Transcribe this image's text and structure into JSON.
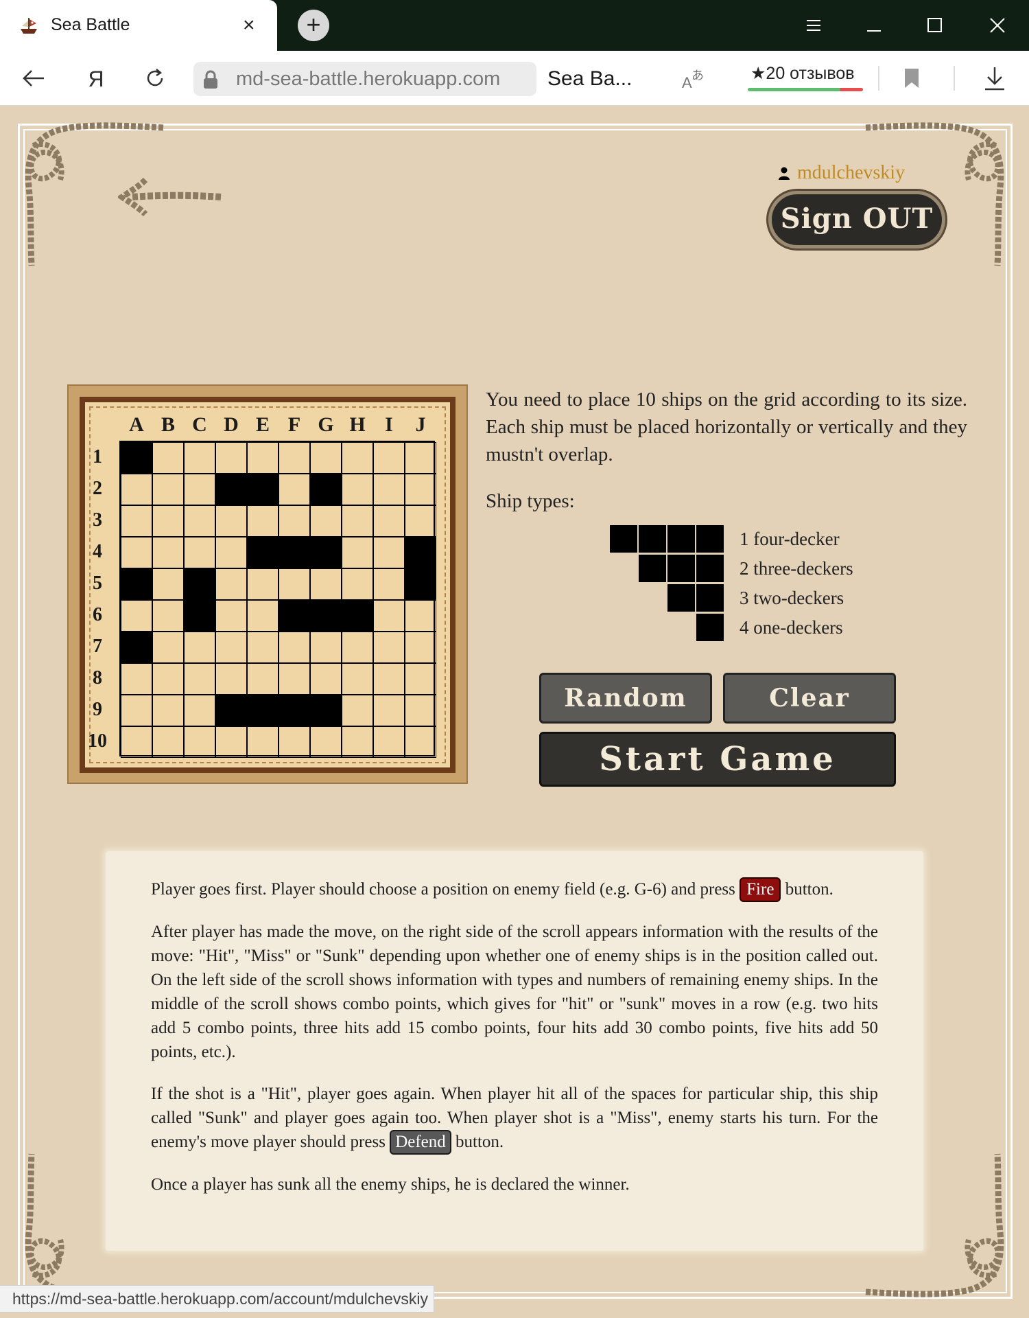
{
  "browser": {
    "tab_title": "Sea Battle",
    "tab_close": "×",
    "new_tab": "+",
    "url": "md-sea-battle.herokuapp.com",
    "page_name": "Sea Ba...",
    "reviews": "★20 отзывов",
    "status_url": "https://md-sea-battle.herokuapp.com/account/mdulchevskiy"
  },
  "header": {
    "username": "mdulchevskiy",
    "sign_out": "Sign OUT"
  },
  "board": {
    "columns": [
      "A",
      "B",
      "C",
      "D",
      "E",
      "F",
      "G",
      "H",
      "I",
      "J"
    ],
    "rows": [
      "1",
      "2",
      "3",
      "4",
      "5",
      "6",
      "7",
      "8",
      "9",
      "10"
    ],
    "ship_cells": [
      "A1",
      "D2",
      "E2",
      "G2",
      "E4",
      "F4",
      "G4",
      "J4",
      "A5",
      "C5",
      "J5",
      "C6",
      "F6",
      "G6",
      "H6",
      "A7",
      "D9",
      "E9",
      "F9",
      "G9"
    ]
  },
  "instructions": {
    "text": "You need to place 10 ships on the grid according to its size. Each ship must be placed horizontally or vertically and they mustn't overlap.",
    "ship_types_title": "Ship types:",
    "ship_types": [
      {
        "label": "1 four-decker",
        "size": 4
      },
      {
        "label": "2 three-deckers",
        "size": 3
      },
      {
        "label": "3 two-deckers",
        "size": 2
      },
      {
        "label": "4 one-deckers",
        "size": 1
      }
    ]
  },
  "buttons": {
    "random": "Random",
    "clear": "Clear",
    "start": "Start Game"
  },
  "rules": {
    "p1_before": "Player goes first. Player should choose a position on enemy field (e.g. G-6) and press ",
    "fire_label": "Fire",
    "p1_after": " button.",
    "p2": "After player has made the move, on the right side of the scroll appears information with the results of the move: \"Hit\", \"Miss\" or \"Sunk\" depending upon whether one of enemy ships is in the position called out. On the left side of the scroll shows information with types and numbers of remaining enemy ships. In the middle of the scroll shows combo points, which gives for \"hit\" or \"sunk\" moves in a row (e.g. two hits add 5 combo points, three hits add 15 combo points, four hits add 30 combo points, five hits add 50 points, etc.).",
    "p3_before": "If the shot is a \"Hit\", player goes again. When player hit all of the spaces for particular ship, this ship called \"Sunk\" and player goes again too. When player shot is a \"Miss\", enemy starts his turn. For the enemy's move player should press ",
    "defend_label": "Defend",
    "p3_after": " button.",
    "p4": "Once a player has sunk all the enemy ships, he is declared the winner."
  },
  "icons": [
    "pirate-ship-icon",
    "close-icon",
    "plus-icon",
    "menu-icon",
    "minimize-icon",
    "maximize-icon",
    "close-window-icon",
    "back-icon",
    "yandex-icon",
    "reload-icon",
    "lock-icon",
    "translate-icon",
    "bookmark-icon",
    "download-icon",
    "user-icon",
    "rope-arrow-icon"
  ]
}
